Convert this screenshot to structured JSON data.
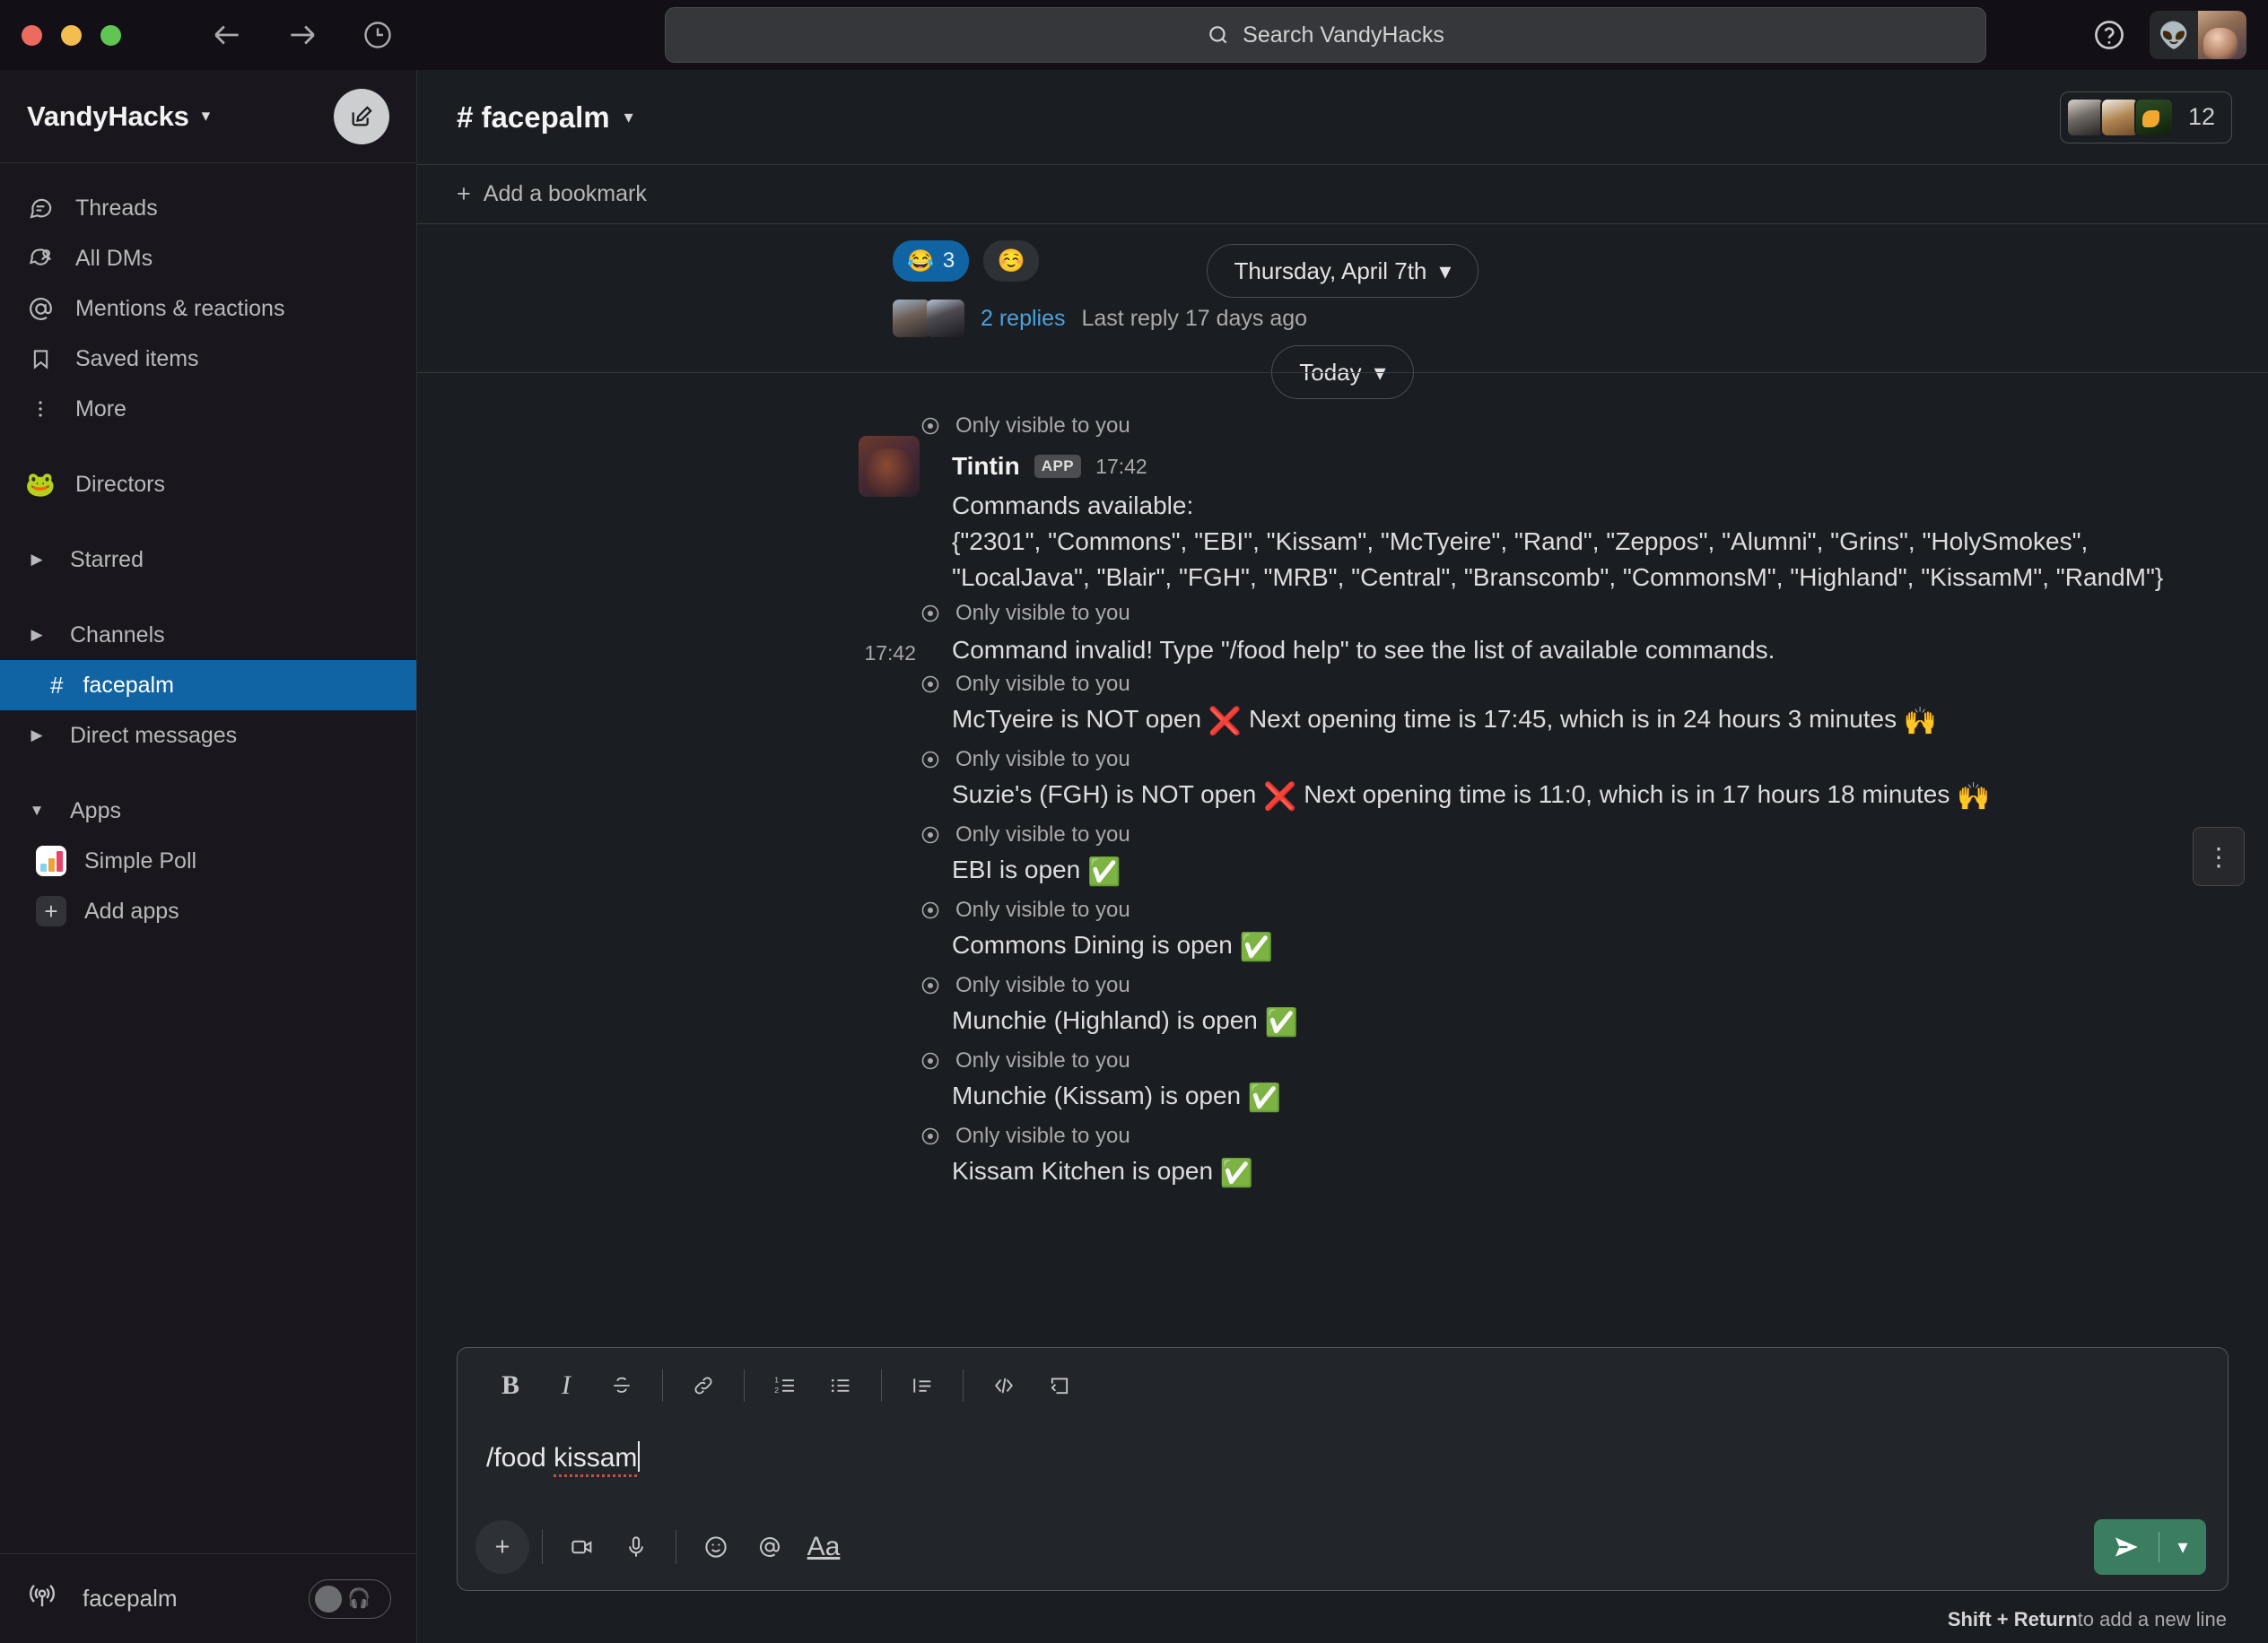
{
  "titlebar": {
    "back_icon": "arrow-left-icon",
    "forward_icon": "arrow-right-icon",
    "history_icon": "clock-icon",
    "search_placeholder": "Search VandyHacks",
    "help_icon": "help-circle-icon"
  },
  "sidebar": {
    "workspace_name": "VandyHacks",
    "compose_icon": "compose-pencil-icon",
    "nav_items": [
      {
        "label": "Threads",
        "icon": "threads-icon"
      },
      {
        "label": "All DMs",
        "icon": "dms-icon"
      },
      {
        "label": "Mentions & reactions",
        "icon": "at-icon"
      },
      {
        "label": "Saved items",
        "icon": "bookmark-icon"
      },
      {
        "label": "More",
        "icon": "more-dots-icon"
      }
    ],
    "pinned": {
      "label": "Directors",
      "emoji": "🐸"
    },
    "sections": [
      {
        "label": "Starred",
        "expanded": false
      },
      {
        "label": "Channels",
        "expanded": false
      }
    ],
    "active_channel": {
      "label": "facepalm",
      "prefix": "#"
    },
    "dm_section": {
      "label": "Direct messages",
      "expanded": false
    },
    "apps_section": {
      "label": "Apps",
      "expanded": true
    },
    "apps": [
      {
        "label": "Simple Poll",
        "icon": "simple-poll-icon"
      },
      {
        "label": "Add apps",
        "icon": "plus-icon"
      }
    ],
    "footer": {
      "huddle_label": "facepalm",
      "huddle_icon": "huddle-broadcast-icon",
      "toggle_state": "off",
      "headphones_icon": "headphones-icon"
    }
  },
  "channel": {
    "name": "facepalm",
    "prefix": "#",
    "member_count": "12",
    "bookmark_label": "Add a bookmark"
  },
  "thread_preview": {
    "reaction_emoji": "😂",
    "reaction_count": "3",
    "add_reaction_icon": "add-reaction-icon",
    "replies_label": "2 replies",
    "last_reply": "Last reply 17 days ago"
  },
  "dividers": {
    "previous_date": "Thursday, April 7th",
    "today": "Today"
  },
  "messages": {
    "ephemeral_label": "Only visible to you",
    "bot": {
      "author": "Tintin",
      "badge": "APP",
      "time": "17:42",
      "line1": "Commands available:",
      "line2": "{\"2301\", \"Commons\", \"EBI\", \"Kissam\", \"McTyeire\", \"Rand\", \"Zeppos\", \"Alumni\", \"Grins\", \"HolySmokes\", \"LocalJava\", \"Blair\", \"FGH\", \"MRB\", \"Central\", \"Branscomb\", \"CommonsM\", \"Highland\", \"KissamM\", \"RandM\"}"
    },
    "invalid": {
      "time": "17:42",
      "text": "Command invalid! Type \"/food help\" to see the list of available commands."
    },
    "statuses": [
      {
        "text": "McTyeire is NOT open",
        "emoji": "❌",
        "suffix": "Next opening time is 17:45, which is in 24 hours 3 minutes",
        "trailing_emoji": "🙌"
      },
      {
        "text": "Suzie's (FGH) is NOT open",
        "emoji": "❌",
        "suffix": "Next opening time is 11:0, which is in 17 hours 18 minutes",
        "trailing_emoji": "🙌"
      },
      {
        "text": "EBI is open",
        "emoji": "✅",
        "suffix": "",
        "trailing_emoji": ""
      },
      {
        "text": "Commons Dining is open",
        "emoji": "✅",
        "suffix": "",
        "trailing_emoji": ""
      },
      {
        "text": "Munchie (Highland) is open",
        "emoji": "✅",
        "suffix": "",
        "trailing_emoji": ""
      },
      {
        "text": "Munchie (Kissam) is open",
        "emoji": "✅",
        "suffix": "",
        "trailing_emoji": ""
      },
      {
        "text": "Kissam Kitchen is open",
        "emoji": "✅",
        "suffix": "",
        "trailing_emoji": ""
      }
    ],
    "more_actions_icon": "more-vertical-icon"
  },
  "composer": {
    "format_buttons": [
      {
        "label": "B",
        "name": "bold-icon"
      },
      {
        "label": "I",
        "name": "italic-icon"
      },
      {
        "label": "S",
        "name": "strikethrough-icon"
      },
      {
        "label": "link",
        "name": "link-icon"
      },
      {
        "label": "ol",
        "name": "ordered-list-icon"
      },
      {
        "label": "ul",
        "name": "bulleted-list-icon"
      },
      {
        "label": "quote",
        "name": "blockquote-icon"
      },
      {
        "label": "code",
        "name": "code-icon"
      },
      {
        "label": "codeblock",
        "name": "code-block-icon"
      }
    ],
    "draft_prefix": "/food ",
    "draft_word": "kissam",
    "action_buttons": [
      {
        "name": "plus-icon"
      },
      {
        "name": "video-icon"
      },
      {
        "name": "microphone-icon"
      },
      {
        "name": "emoji-icon"
      },
      {
        "name": "mention-icon"
      },
      {
        "name": "formatting-icon"
      }
    ],
    "send_icon": "send-paper-plane-icon",
    "send_caret_icon": "chevron-down-icon",
    "hint_bold": "Shift + Return",
    "hint_rest": " to add a new line"
  },
  "colors": {
    "accent_blue": "#1164a3",
    "send_green": "#3a7d60",
    "link_blue": "#4aa2e0",
    "sidebar_bg": "#19171d",
    "main_bg": "#1a1d21"
  }
}
